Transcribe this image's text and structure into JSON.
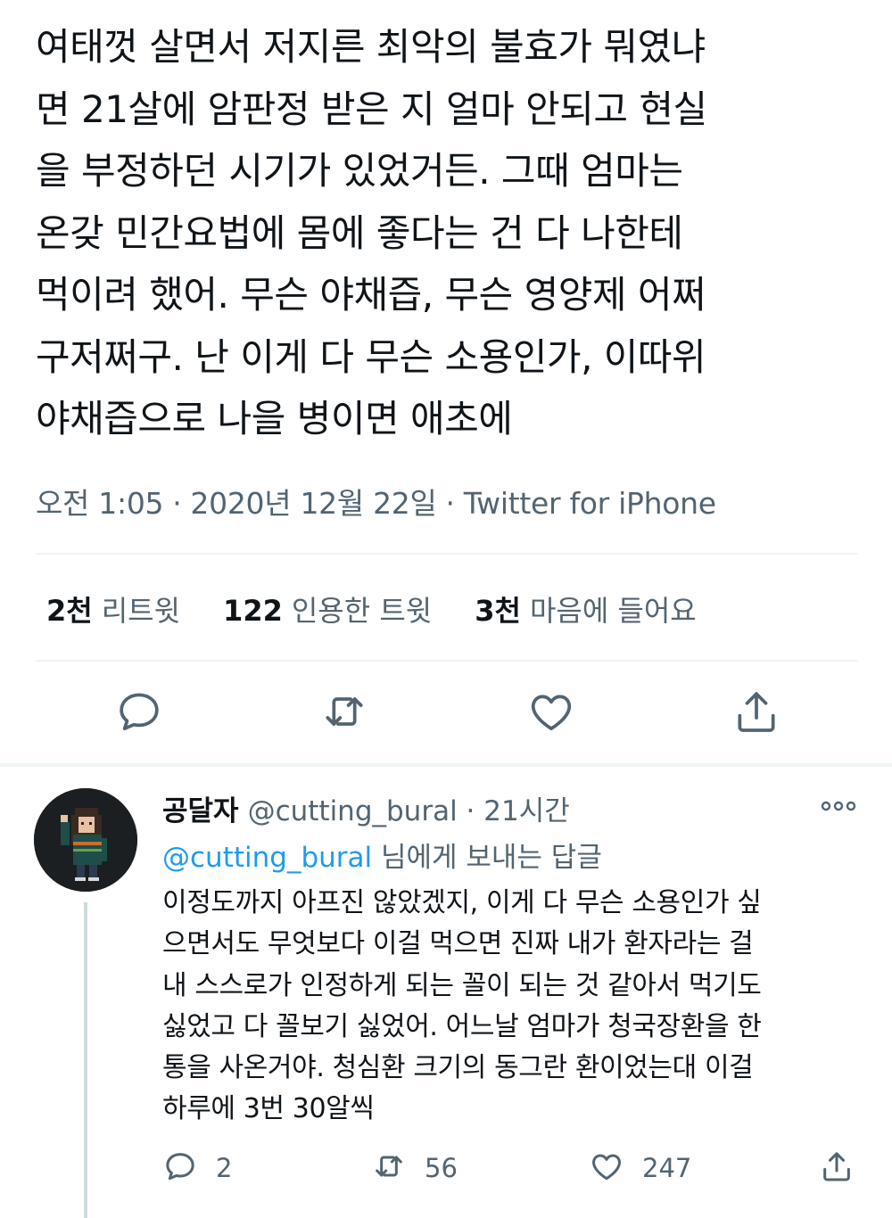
{
  "tweet": {
    "lines": [
      "여태껏 살면서 저지른 최악의 불효가 뭐였냐",
      "면 21살에 암판정 받은 지 얼마 안되고 현실",
      "을 부정하던 시기가 있었거든. 그때 엄마는",
      "온갖 민간요법에 몸에 좋다는 건 다 나한테",
      "먹이려 했어. 무슨 야채즙, 무슨 영양제 어쩌",
      "구저쩌구. 난 이게 다 무슨 소용인가, 이따위",
      "야채즙으로 나을 병이면 애초에"
    ],
    "time": "오전 1:05",
    "date": "2020년 12월 22일",
    "source": "Twitter for iPhone",
    "separator": "·"
  },
  "stats": {
    "retweets": {
      "num": "2천",
      "label": "리트윗"
    },
    "quotes": {
      "num": "122",
      "label": "인용한 트윗"
    },
    "likes": {
      "num": "3천",
      "label": "마음에 들어요"
    }
  },
  "actions": {
    "icons": [
      "reply-icon",
      "retweet-icon",
      "like-icon",
      "share-icon"
    ]
  },
  "reply": {
    "name": "공달자",
    "handle": "@cutting_bural",
    "separator": "·",
    "time": "21시간",
    "replying_mention": "@cutting_bural",
    "replying_suffix": " 님에게 보내는 답글",
    "lines": [
      "이정도까지 아프진 않았겠지, 이게 다 무슨 소용인가 싶",
      "으면서도 무엇보다 이걸 먹으면 진짜 내가 환자라는 걸",
      "내 스스로가 인정하게 되는 꼴이 되는 것 같아서 먹기도",
      "싫었고 다 꼴보기 싫었어. 어느날 엄마가 청국장환을 한",
      "통을 사온거야. 청심환 크기의 동그란 환이었는대 이걸",
      "하루에 3번 30알씩"
    ],
    "reply_count": "2",
    "retweet_count": "56",
    "like_count": "247"
  },
  "colors": {
    "text": "#0f1419",
    "secondary": "#536471",
    "accent": "#1d9bf0",
    "divider": "#eff3f4"
  }
}
